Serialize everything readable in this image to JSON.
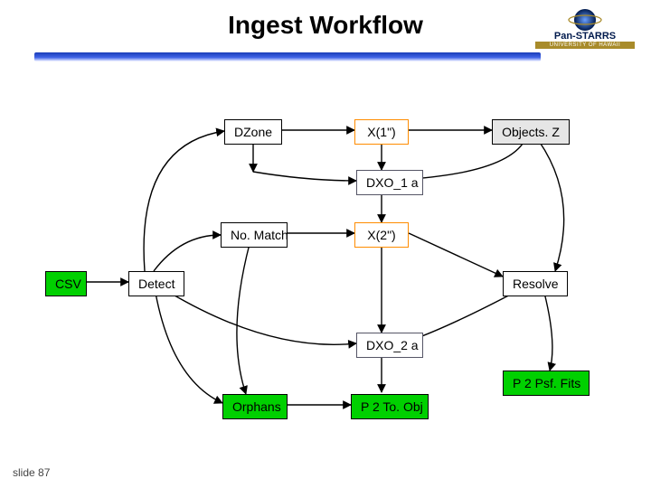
{
  "title": "Ingest Workflow",
  "logo": {
    "name": "Pan-STARRS",
    "sub": "UNIVERSITY OF HAWAII"
  },
  "footer": "slide 87",
  "nodes": {
    "dzone": "DZone",
    "x1": "X(1\")",
    "objectsz": "Objects. Z",
    "dxo1a": "DXO_1 a",
    "nomatch": "No. Match",
    "x2": "X(2\")",
    "csv": "CSV",
    "detect": "Detect",
    "resolve": "Resolve",
    "dxo2a": "DXO_2 a",
    "p2psf": "P 2 Psf. Fits",
    "orphans": "Orphans",
    "p2toobj": "P 2 To. Obj"
  }
}
